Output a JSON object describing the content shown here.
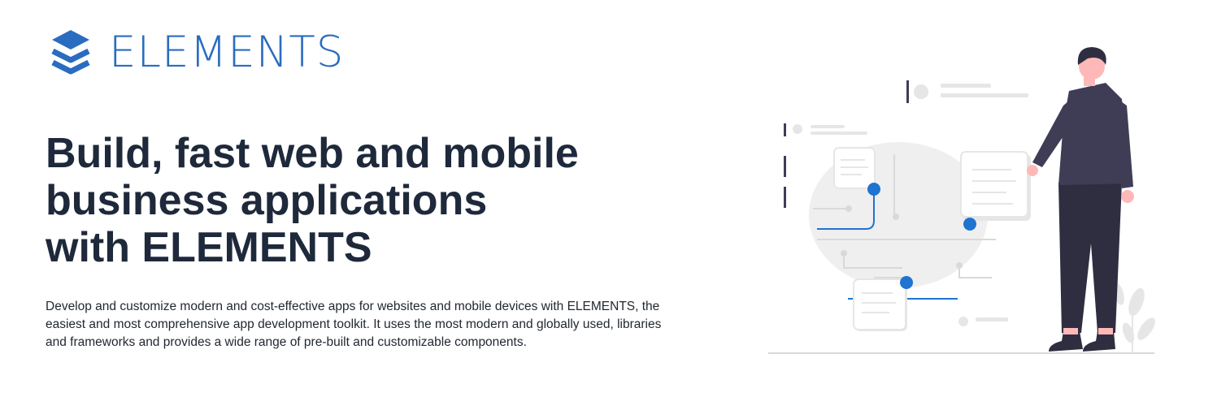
{
  "brand": {
    "name": "ELEMENTS",
    "color": "#2a6cc0",
    "icon": "layers-icon"
  },
  "hero": {
    "headline_lines": [
      "Build, fast web and mobile",
      "business applications",
      "with ELEMENTS"
    ],
    "description": "Develop and customize modern and cost-effective apps for websites and mobile devices with ELEMENTS, the easiest and most comprehensive app development toolkit. It uses the most modern and globally used, libraries and frameworks and provides a wide range of pre-built and customizable components."
  },
  "illustration": {
    "subject": "person-with-ui-cards-illustration",
    "accent_color": "#1f73d1"
  }
}
